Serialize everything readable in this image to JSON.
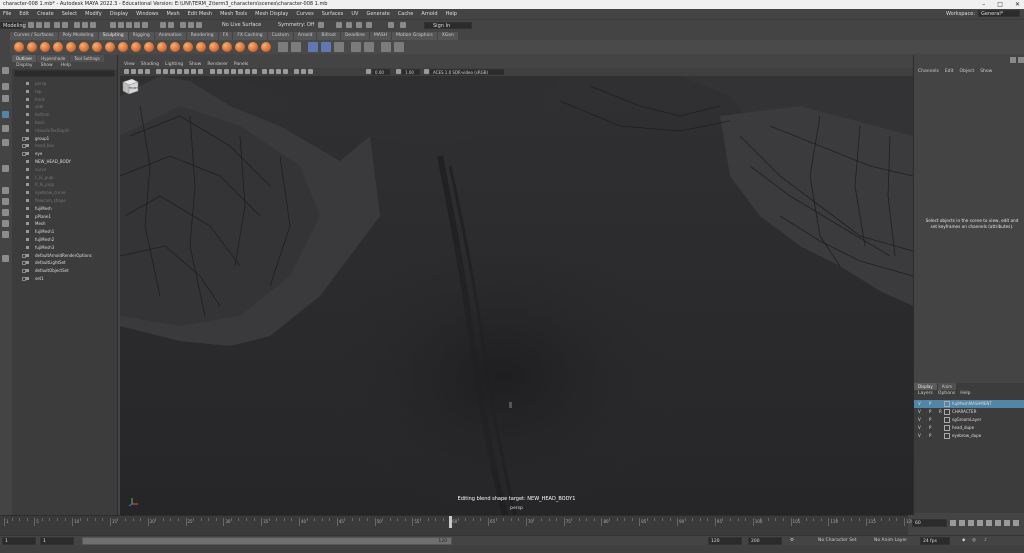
{
  "titlebar": {
    "title": "character-008 1.mb* - Autodesk MAYA 2022.3 - Educational Version: E:\\UNI\\TERM_2\\term3_characters\\scenes\\character-008 1.mb"
  },
  "menubar": {
    "items": [
      "File",
      "Edit",
      "Create",
      "Select",
      "Modify",
      "Display",
      "Windows",
      "Mesh",
      "Edit Mesh",
      "Mesh Tools",
      "Mesh Display",
      "Curves",
      "Surfaces",
      "UV",
      "Generate",
      "Cache",
      "Arnold",
      "Help"
    ],
    "workspace_label": "Workspace:",
    "workspace_value": "General*"
  },
  "statusline": {
    "mode": "Modeling",
    "live_surface": "No Live Surface",
    "symmetry": "Symmetry: Off",
    "sign_in": "Sign In"
  },
  "shelf_tabs": [
    "Curves / Surfaces",
    "Poly Modeling",
    "Sculpting",
    "Rigging",
    "Animation",
    "Rendering",
    "FX",
    "FX Caching",
    "Custom",
    "Arnold",
    "Bifrost",
    "Deadline",
    "MASH",
    "Motion Graphics",
    "XGen"
  ],
  "shelf_active": "Sculpting",
  "outliner": {
    "tabs": [
      "Outliner",
      "Hypershade",
      "Tool Settings"
    ],
    "menu": [
      "Display",
      "Show",
      "Help"
    ],
    "rows": [
      {
        "label": "persp",
        "dim": true
      },
      {
        "label": "top",
        "dim": true
      },
      {
        "label": "front",
        "dim": true
      },
      {
        "label": "side",
        "dim": true
      },
      {
        "label": "bottom",
        "dim": true
      },
      {
        "label": "back",
        "dim": true
      },
      {
        "label": "ntaudioTextSaphl",
        "dim": true
      },
      {
        "label": "group1",
        "dim": false,
        "exp": true
      },
      {
        "label": "head_box",
        "dim": true,
        "exp": true
      },
      {
        "label": "eye",
        "dim": false,
        "exp": true
      },
      {
        "label": "NEW_HEAD_BODY",
        "dim": false
      },
      {
        "label": "curve",
        "dim": true
      },
      {
        "label": "L_Ik_pulp",
        "dim": true
      },
      {
        "label": "R_Ik_pulp",
        "dim": true
      },
      {
        "label": "eyebrow_curve",
        "dim": true
      },
      {
        "label": "flowcam_shape",
        "dim": true
      },
      {
        "label": "fujiMesh",
        "dim": false
      },
      {
        "label": "pPlane1",
        "dim": false
      },
      {
        "label": "Mesh",
        "dim": false
      },
      {
        "label": "fujiMesh1",
        "dim": false
      },
      {
        "label": "fujiMesh2",
        "dim": false
      },
      {
        "label": "fujiMesh3",
        "dim": false
      },
      {
        "label": "defaultArnoldRenderOptions",
        "dim": false,
        "exp": true
      },
      {
        "label": "defaultLightSet",
        "dim": false,
        "exp": true
      },
      {
        "label": "defaultObjectSet",
        "dim": false,
        "exp": true
      },
      {
        "label": "set1",
        "dim": false,
        "exp": true
      }
    ]
  },
  "viewport": {
    "menu": [
      "View",
      "Shading",
      "Lighting",
      "Show",
      "Renderer",
      "Panels"
    ],
    "exposure": "0.00",
    "gamma": "1.00",
    "color_space": "ACES 1.0 SDR-video (sRGB)",
    "caption": "Editing blend shape target: NEW_HEAD_BODY1",
    "camera": "persp",
    "viewcube_label": "FRONT"
  },
  "channelbox": {
    "menu": [
      "Channels",
      "Edit",
      "Object",
      "Show"
    ],
    "hint": "Select objects in the scene to view, edit and set keyframes on channels (attributes)."
  },
  "layers": {
    "tabs": [
      "Display",
      "Anim"
    ],
    "menu": [
      "Layers",
      "Options",
      "Help"
    ],
    "rows": [
      {
        "v": "V",
        "p": "P",
        "r": "",
        "name": "fujiMeshMASHMENT",
        "selected": true
      },
      {
        "v": "V",
        "p": "P",
        "r": "R",
        "name": "CHARACTER",
        "selected": false
      },
      {
        "v": "V",
        "p": "P",
        "r": "",
        "name": "sgGroomLayer",
        "selected": false
      },
      {
        "v": "V",
        "p": "P",
        "r": "",
        "name": "head_dupe",
        "selected": false
      },
      {
        "v": "V",
        "p": "P",
        "r": "",
        "name": "eyebrow_dupe",
        "selected": false
      }
    ]
  },
  "timeline": {
    "labels": [
      "1",
      "5",
      "10",
      "15",
      "20",
      "25",
      "30",
      "35",
      "40",
      "45",
      "50",
      "55",
      "60",
      "65",
      "70",
      "75",
      "80",
      "85",
      "90",
      "95",
      "100",
      "105",
      "110",
      "115",
      "120"
    ],
    "current_frame": "60"
  },
  "range": {
    "start": "1",
    "start_inner": "1",
    "slider_end": "120",
    "end_inner": "120",
    "end": "200",
    "character_set": "No Character Set",
    "anim_layer": "No Anim Layer",
    "fps": "24 fps"
  }
}
